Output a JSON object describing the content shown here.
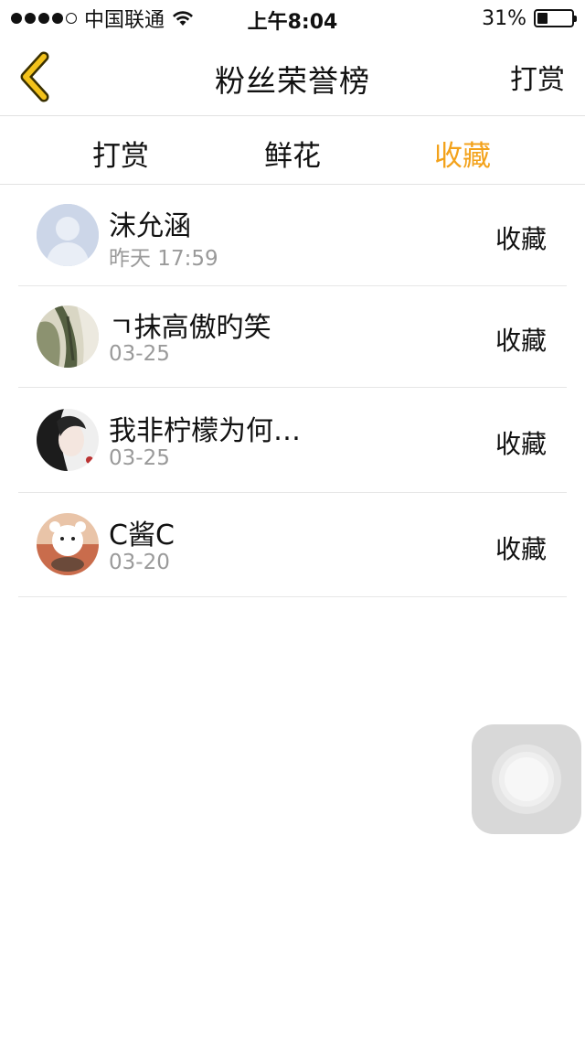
{
  "status_bar": {
    "carrier": "中国联通",
    "time": "上午8:04",
    "battery_percent": "31%",
    "signal_bars": 4,
    "battery_level": 0.31
  },
  "nav": {
    "title": "粉丝荣誉榜",
    "back_icon": "chevron-left-icon",
    "right_label": "打赏",
    "accent_color": "#f3c21b"
  },
  "tabs": [
    {
      "label": "打赏",
      "active": false
    },
    {
      "label": "鲜花",
      "active": false
    },
    {
      "label": "收藏",
      "active": true,
      "color": "#f3a21b"
    }
  ],
  "list": [
    {
      "name": "沫允涵",
      "date": "昨天 17:59",
      "action": "收藏",
      "avatar": "default-avatar-icon"
    },
    {
      "name": "ㄱ抹高傲旳笑",
      "date": "03-25",
      "action": "收藏",
      "avatar": "photo-avatar"
    },
    {
      "name": "我非柠檬为何…",
      "date": "03-25",
      "action": "收藏",
      "avatar": "photo-avatar"
    },
    {
      "name": "C酱C",
      "date": "03-20",
      "action": "收藏",
      "avatar": "photo-avatar"
    }
  ]
}
